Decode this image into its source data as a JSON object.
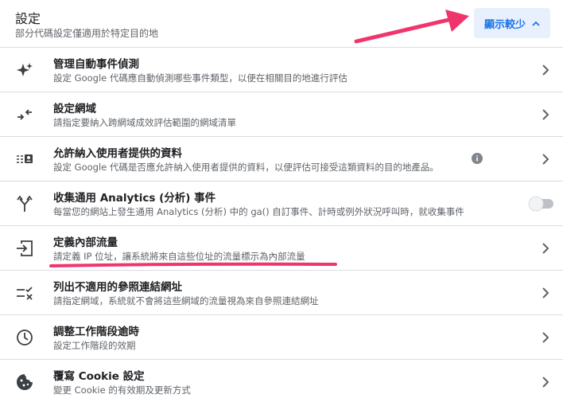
{
  "header": {
    "title": "設定",
    "subtitle": "部分代碼設定僅適用於特定目的地",
    "toggle_label": "顯示較少",
    "toggle_icon": "chevron-up-icon"
  },
  "annotation_color": "#f0356c",
  "accent": "#1a73e8",
  "rows": [
    {
      "title": "管理自動事件偵測",
      "desc": "設定 Google 代碼應自動偵測哪些事件類型，以便在相關目的地進行評估",
      "icon": "sparkle-icon",
      "control": "chevron-right-icon"
    },
    {
      "title": "設定網域",
      "desc": "請指定要納入跨網域成效評估範圍的網域清單",
      "icon": "arrows-inward-icon",
      "control": "chevron-right-icon"
    },
    {
      "title": "允許納入使用者提供的資料",
      "desc": "設定 Google 代碼是否應允許納入使用者提供的資料，以便評估可接受這類資料的目的地產品。",
      "icon": "user-data-icon",
      "control": "chevron-right-icon",
      "extra": "info-icon"
    },
    {
      "title": "收集通用 Analytics (分析) 事件",
      "desc": "每當您的網站上發生通用 Analytics (分析) 中的 ga() 自訂事件、計時或例外狀況呼叫時，就收集事件",
      "icon": "merge-arrow-icon",
      "control": "toggle-switch-off"
    },
    {
      "title": "定義內部流量",
      "desc": "請定義 IP 位址，讓系統將來自這些位址的流量標示為內部流量",
      "icon": "input-arrow-icon",
      "control": "chevron-right-icon"
    },
    {
      "title": "列出不適用的參照連結網址",
      "desc": "請指定網域，系統就不會將這些網域的流量視為來自參照連結網址",
      "icon": "list-check-x-icon",
      "control": "chevron-right-icon"
    },
    {
      "title": "調整工作階段逾時",
      "desc": "設定工作階段的效期",
      "icon": "clock-icon",
      "control": "chevron-right-icon"
    },
    {
      "title": "覆寫 Cookie 設定",
      "desc": "變更 Cookie 的有效期及更新方式",
      "icon": "cookie-icon",
      "control": "chevron-right-icon"
    }
  ]
}
